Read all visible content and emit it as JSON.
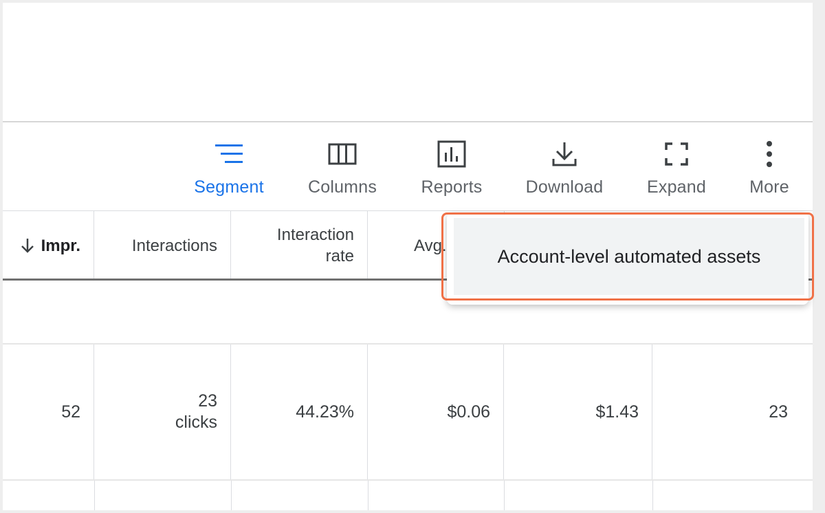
{
  "toolbar": {
    "segment": "Segment",
    "columns": "Columns",
    "reports": "Reports",
    "download": "Download",
    "expand": "Expand",
    "more": "More"
  },
  "table": {
    "headers": {
      "impr": "Impr.",
      "interactions": "Interactions",
      "interaction_rate_line1": "Interaction",
      "interaction_rate_line2": "rate",
      "avg": "Avg."
    },
    "row": {
      "impr": "52",
      "interactions_count": "23",
      "interactions_unit": "clicks",
      "interaction_rate": "44.23%",
      "avg_cost": "$0.06",
      "cost": "$1.43",
      "last": "23"
    }
  },
  "menu": {
    "item": "Account-level automated assets"
  },
  "colors": {
    "accent": "#1a73e8",
    "highlight": "#f07147"
  }
}
